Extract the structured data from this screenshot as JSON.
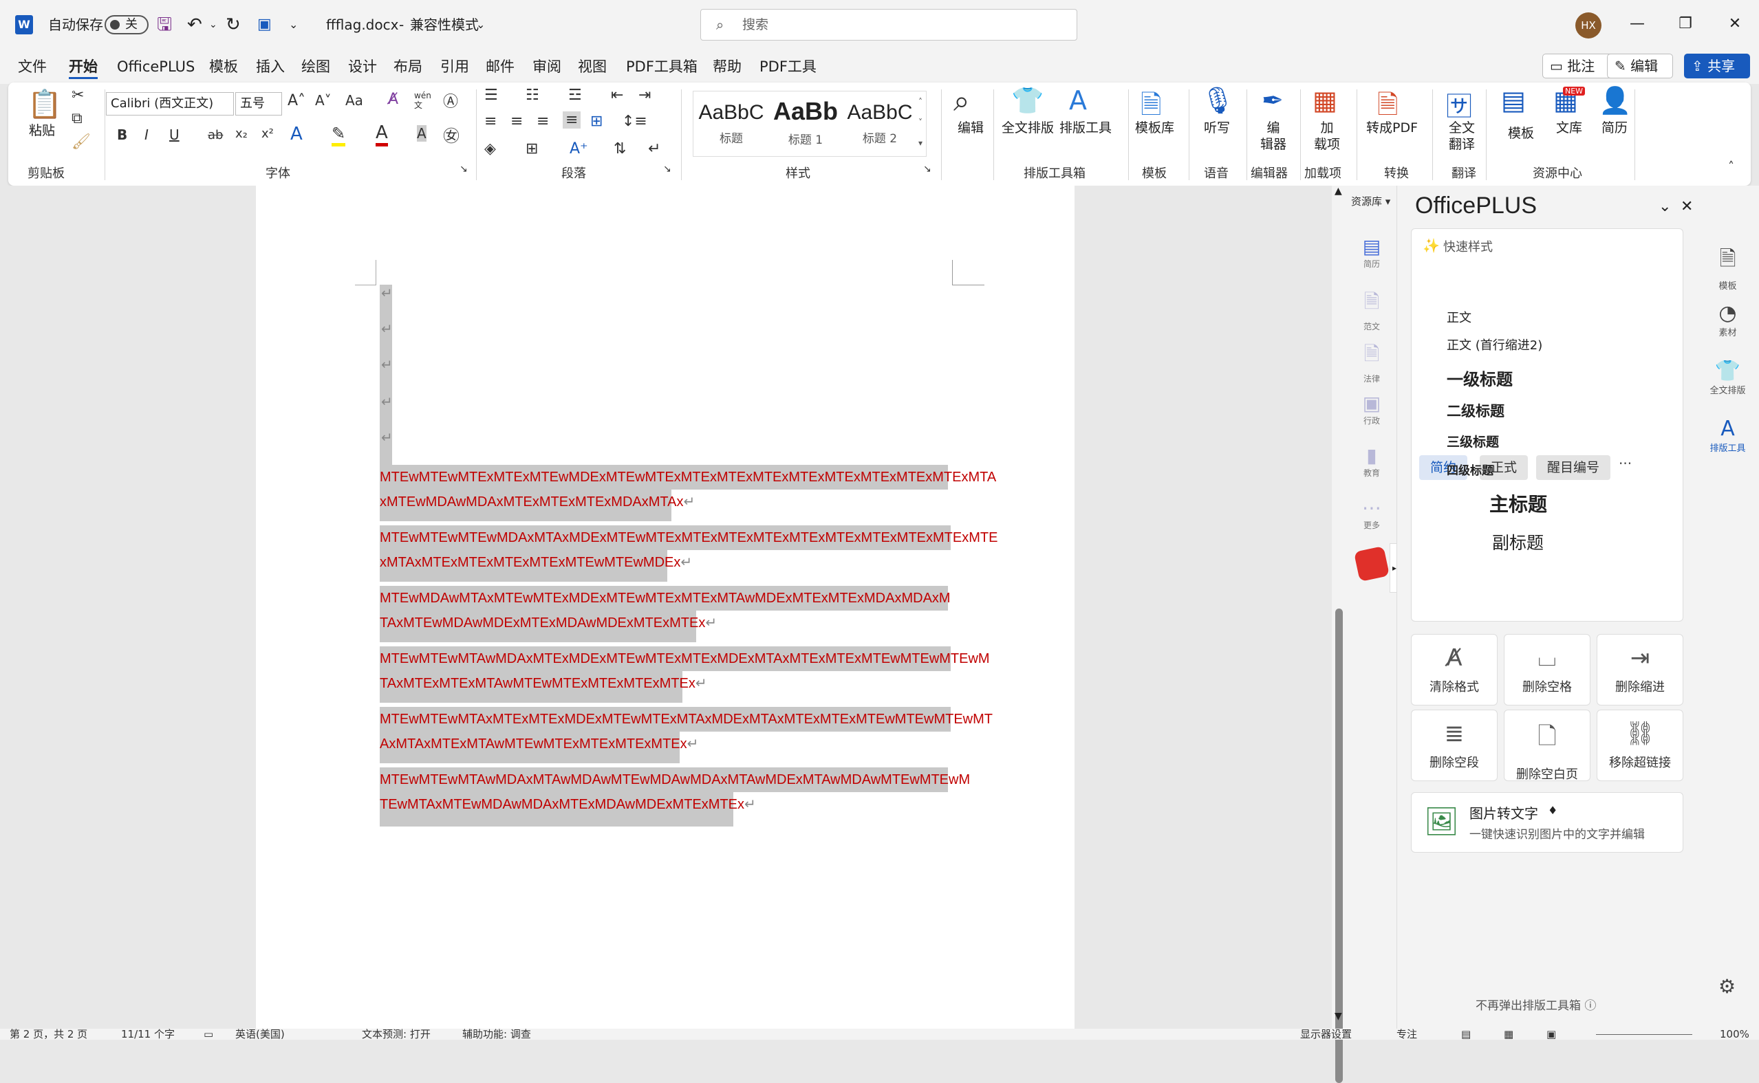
{
  "titlebar": {
    "app_icon": "word-icon",
    "autosave_label": "自动保存",
    "autosave_state": "关",
    "filename": "ffflag.docx",
    "separator": "-",
    "mode": "兼容性模式",
    "search_placeholder": "搜索",
    "avatar_initials": "HX"
  },
  "menu": {
    "items": [
      "文件",
      "开始",
      "OfficePLUS",
      "模板",
      "插入",
      "绘图",
      "设计",
      "布局",
      "引用",
      "邮件",
      "审阅",
      "视图",
      "PDF工具箱",
      "帮助",
      "PDF工具"
    ],
    "active": "开始",
    "comment_btn": "批注",
    "edit_btn": "编辑",
    "share_btn": "共享"
  },
  "ribbon": {
    "clipboard": {
      "paste": "粘贴",
      "group": "剪贴板"
    },
    "font": {
      "name": "Calibri (西文正文)",
      "size": "五号",
      "group": "字体",
      "bold": "B",
      "italic": "I",
      "underline": "U",
      "strike": "ab",
      "sub": "x₂",
      "sup": "x²",
      "wen": "wén"
    },
    "paragraph": {
      "group": "段落"
    },
    "styles": {
      "items": [
        {
          "sample": "AaBbC",
          "name": "标题"
        },
        {
          "sample": "AaBb",
          "name": "标题 1"
        },
        {
          "sample": "AaBbC",
          "name": "标题 2"
        }
      ],
      "group": "样式"
    },
    "edit": {
      "label": "编辑"
    },
    "typeset": {
      "full": "全文排版",
      "tools": "排版工具",
      "group": "排版工具箱"
    },
    "template": {
      "label": "模板库",
      "group": "模板"
    },
    "voice": {
      "label": "听写",
      "group": "语音"
    },
    "editor": {
      "label1": "编",
      "label2": "辑器",
      "group": "编辑器"
    },
    "addins": {
      "label1": "加",
      "label2": "载项",
      "group": "加载项"
    },
    "convert": {
      "label": "转成PDF",
      "group": "转换"
    },
    "translate": {
      "label1": "全文",
      "label2": "翻译",
      "group": "翻译"
    },
    "resources": {
      "template": "模板",
      "library": "文库",
      "resume": "简历",
      "group": "资源中心",
      "new_badge": "NEW"
    }
  },
  "document": {
    "lines": [
      "MTEwMTEwMTExMTExMTEwMDExMTEwMTExMTExMTExMTExMTExMTExMTExMTExMTExMTA",
      "xMTEwMDAwMDAxMTExMTExMTExMDAxMTAx",
      "MTEwMTEwMTEwMDAxMTAxMDExMTEwMTExMTExMTExMTExMTExMTExMTExMTExMTExMTE",
      "xMTAxMTExMTExMTExMTExMTEwMTEwMDEx",
      "MTEwMDAwMTAxMTEwMTExMDExMTEwMTExMTExMTAwMDExMTExMTExMDAxMDAxM",
      "TAxMTEwMDAwMDExMTExMDAwMDExMTExMTEx",
      "MTEwMTEwMTAwMDAxMTExMDExMTEwMTExMTExMDExMTAxMTExMTExMTEwMTEwMTEwM",
      "TAxMTExMTExMTAwMTEwMTExMTExMTExMTEx",
      "MTEwMTEwMTAxMTExMTExMDExMTEwMTExMTAxMDExMTAxMTExMTExMTEwMTEwMTEwMT",
      "AxMTAxMTExMTAwMTEwMTExMTExMTExMTEx",
      "MTEwMTEwMTAwMDAxMTAwMDAwMTEwMDAwMDAxMTAwMDExMTAwMDAwMTEwMTEwM",
      "TEwMTAxMTEwMDAwMDAxMTExMDAwMDExMTExMTEx"
    ],
    "paragraph_mark": "↵"
  },
  "resource_rail": {
    "header": "资源库",
    "items": [
      "简历",
      "范文",
      "法律",
      "行政",
      "教育",
      "更多"
    ]
  },
  "panel": {
    "title": "OfficePLUS",
    "quick_style": "快速样式",
    "chips": [
      "简约",
      "正式",
      "醒目编号"
    ],
    "more": "···",
    "styles": [
      {
        "label": "正文"
      },
      {
        "label": "正文 (首行缩进2)"
      },
      {
        "label": "一级标题"
      },
      {
        "label": "二级标题"
      },
      {
        "label": "三级标题"
      },
      {
        "label": "四级标题"
      },
      {
        "label": "主标题"
      },
      {
        "label": "副标题"
      }
    ],
    "tools": [
      {
        "label": "清除格式",
        "icon": "clear-format-icon"
      },
      {
        "label": "删除空格",
        "icon": "delete-space-icon"
      },
      {
        "label": "删除缩进",
        "icon": "delete-indent-icon"
      },
      {
        "label": "删除空段",
        "icon": "delete-empty-paragraph-icon"
      },
      {
        "label": "删除空白页",
        "icon": "delete-blank-page-icon"
      },
      {
        "label": "移除超链接",
        "icon": "remove-hyperlink-icon"
      }
    ],
    "ocr_title": "图片转文字",
    "ocr_desc": "一键快速识别图片中的文字并编辑",
    "footer": "不再弹出排版工具箱 ⓘ"
  },
  "side_rail": {
    "items": [
      "模板",
      "素材",
      "全文排版",
      "排版工具"
    ],
    "active": "排版工具"
  },
  "statusbar": {
    "page": "第 2 页，共 2 页",
    "words": "11/11 个字",
    "lang": "英语(美国)",
    "predict": "文本预测: 打开",
    "accessibility": "辅助功能: 调查",
    "display": "显示器设置",
    "focus": "专注",
    "zoom": "100%"
  },
  "colors": {
    "accent": "#185abd",
    "doc_text": "#c00000",
    "highlight": "#c8c8c8"
  }
}
